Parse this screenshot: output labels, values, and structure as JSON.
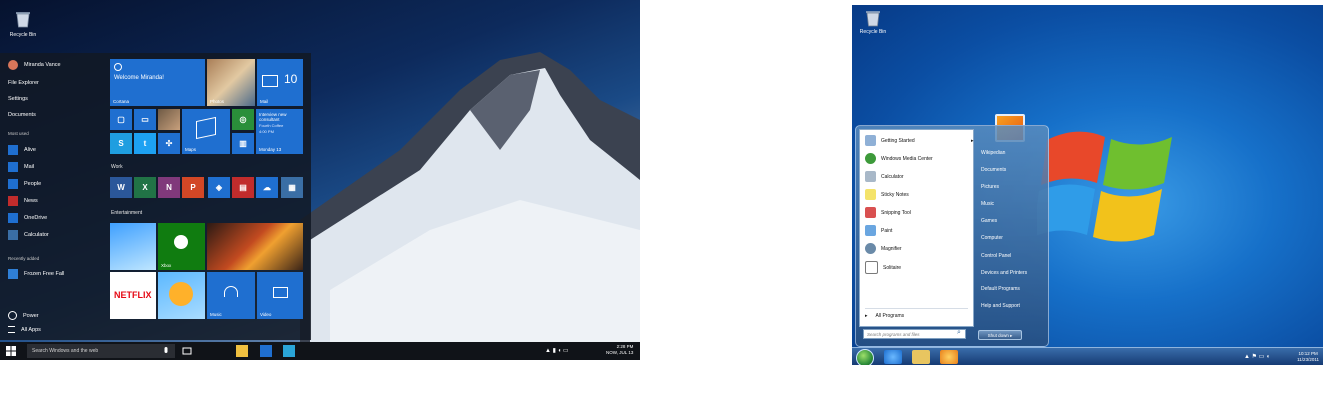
{
  "win10": {
    "desktop_icon": "Recycle Bin",
    "user": "Miranda Vance",
    "left_top": [
      "File Explorer",
      "Settings",
      "Documents"
    ],
    "most_used_caption": "Most used",
    "most_used": [
      "Alive",
      "Mail",
      "People",
      "News",
      "OneDrive",
      "Calculator"
    ],
    "recently_added_caption": "Recently added",
    "recent_app": "Frozen Free Fall",
    "power": "Power",
    "all_apps": "All Apps",
    "tiles": {
      "cortana_greeting": "Welcome Miranda!",
      "cortana": "Cortana",
      "mail_count": "10",
      "mail": "Mail",
      "photos": "Photos",
      "calendar_event": "Interview new consultant",
      "calendar_room": "Fourth Coffee",
      "calendar_time": "4:00 PM",
      "calendar_date": "Monday 13",
      "maps": "Maps",
      "work_group": "Work",
      "entertainment_group": "Entertainment",
      "xbox": "Xbox",
      "netflix": "NETFLIX",
      "music": "Music",
      "video": "Video"
    },
    "search_placeholder": "Search Windows and the web",
    "clock_time": "2:28 PM",
    "clock_date": "NOW, JUL 13"
  },
  "win7": {
    "desktop_icon": "Recycle Bin",
    "programs": [
      "Getting Started",
      "Windows Media Center",
      "Calculator",
      "Sticky Notes",
      "Snipping Tool",
      "Paint",
      "Magnifier",
      "Solitaire"
    ],
    "all_programs": "All Programs",
    "search_placeholder": "Search programs and files",
    "right_items": [
      "Wikipedian",
      "Documents",
      "Pictures",
      "Music",
      "Games",
      "Computer",
      "Control Panel",
      "Devices and Printers",
      "Default Programs",
      "Help and Support"
    ],
    "shutdown": "Shut down",
    "clock_time": "10:12 PM",
    "clock_date": "11/23/2011"
  }
}
